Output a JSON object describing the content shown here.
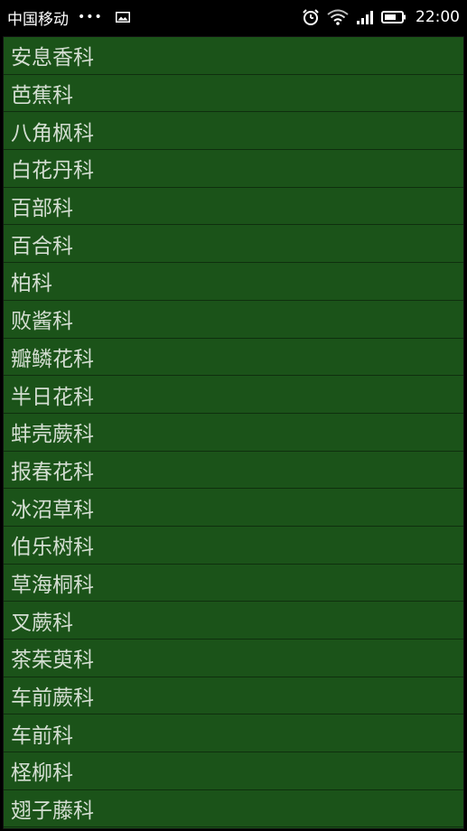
{
  "status_bar": {
    "carrier": "中国移动",
    "dots": "•••",
    "time": "22:00",
    "icons": {
      "image": "image-icon",
      "alarm": "alarm-clock-icon",
      "wifi": "wifi-icon",
      "signal": "cell-signal-icon",
      "battery": "battery-icon"
    }
  },
  "list": {
    "items": [
      {
        "label": "安息香科"
      },
      {
        "label": "芭蕉科"
      },
      {
        "label": "八角枫科"
      },
      {
        "label": "白花丹科"
      },
      {
        "label": "百部科"
      },
      {
        "label": "百合科"
      },
      {
        "label": "柏科"
      },
      {
        "label": "败酱科"
      },
      {
        "label": "瓣鳞花科"
      },
      {
        "label": "半日花科"
      },
      {
        "label": "蚌壳蕨科"
      },
      {
        "label": "报春花科"
      },
      {
        "label": "冰沼草科"
      },
      {
        "label": "伯乐树科"
      },
      {
        "label": "草海桐科"
      },
      {
        "label": "叉蕨科"
      },
      {
        "label": "茶茱萸科"
      },
      {
        "label": "车前蕨科"
      },
      {
        "label": "车前科"
      },
      {
        "label": "柽柳科"
      },
      {
        "label": "翅子藤科"
      }
    ]
  },
  "colors": {
    "list_background": "#1b5319",
    "divider": "#0f2f0e",
    "item_text": "#d4ded2",
    "status_bar_background": "#000000"
  }
}
